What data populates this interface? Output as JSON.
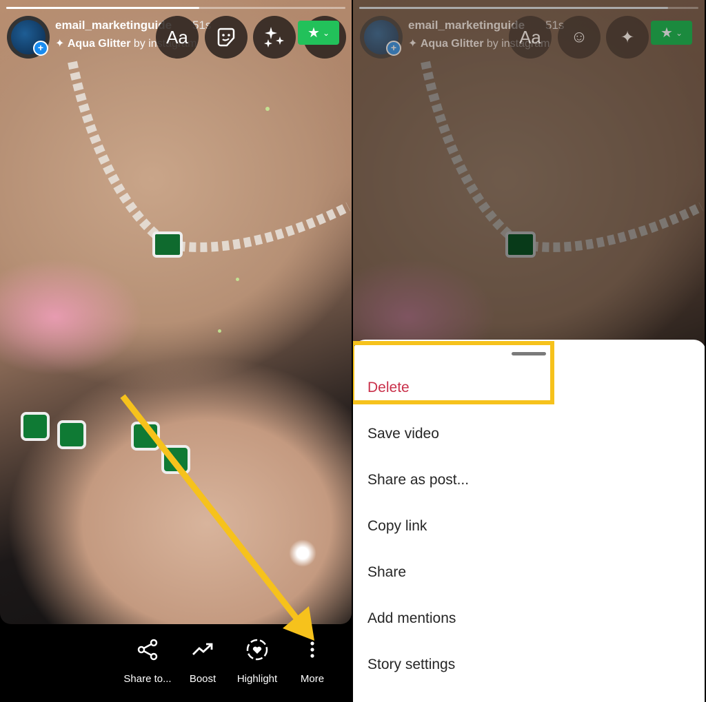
{
  "left_panel": {
    "story": {
      "progress": 0.57,
      "username": "email_marketinguide",
      "time_ago": "51s",
      "effect_name": "Aqua Glitter",
      "effect_by": "by instagram",
      "avatar_icon": "profile-avatar",
      "add_icon": "+"
    },
    "top_controls": [
      {
        "name": "text-tool",
        "glyph": "Aa"
      },
      {
        "name": "sticker-tool",
        "glyph": "sticker"
      },
      {
        "name": "effects-tool",
        "glyph": "sparkles"
      },
      {
        "name": "close-friends",
        "glyph": "★"
      }
    ],
    "bottom_actions": [
      {
        "label": "Share to...",
        "icon": "share-icon"
      },
      {
        "label": "Boost",
        "icon": "trending-up-icon"
      },
      {
        "label": "Highlight",
        "icon": "highlight-heart-icon"
      },
      {
        "label": "More",
        "icon": "more-vertical-icon"
      }
    ],
    "annotation": {
      "arrow_color": "#f6c21c"
    }
  },
  "right_panel": {
    "story": {
      "progress": 0.91,
      "username": "email_marketinguide",
      "time_ago": "51s",
      "effect_name": "Aqua Glitter",
      "effect_by": "by instagram"
    },
    "menu": {
      "items": [
        {
          "label": "Delete",
          "style": "danger"
        },
        {
          "label": "Save video"
        },
        {
          "label": "Share as post..."
        },
        {
          "label": "Copy link"
        },
        {
          "label": "Share"
        },
        {
          "label": "Add mentions"
        },
        {
          "label": "Story settings"
        }
      ]
    },
    "annotation": {
      "highlight_color": "#f6c21c",
      "highlighted_item": "Delete"
    }
  },
  "colors": {
    "danger": "#c9304a",
    "close_friends_green": "#22c15a",
    "annotation_yellow": "#f6c21c"
  }
}
